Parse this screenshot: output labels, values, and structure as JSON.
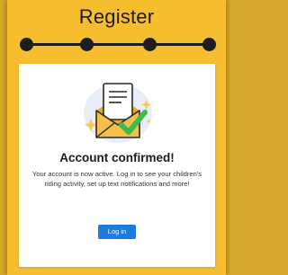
{
  "header": {
    "title": "Register"
  },
  "stepper": {
    "steps": 4,
    "current_step": 4
  },
  "card": {
    "illustration_icon": "envelope-check-icon",
    "heading": "Account confirmed!",
    "message": "Your account is now active. Log in to see your children's riding activity, set up text notifications and more!",
    "login_button": "Log in"
  },
  "colors": {
    "background": "#f6be2f",
    "card": "#ffffff",
    "stepper": "#1e1e1e",
    "button": "#1f7ae0",
    "check": "#3dbb4a",
    "envelope": "#f4c04a"
  }
}
